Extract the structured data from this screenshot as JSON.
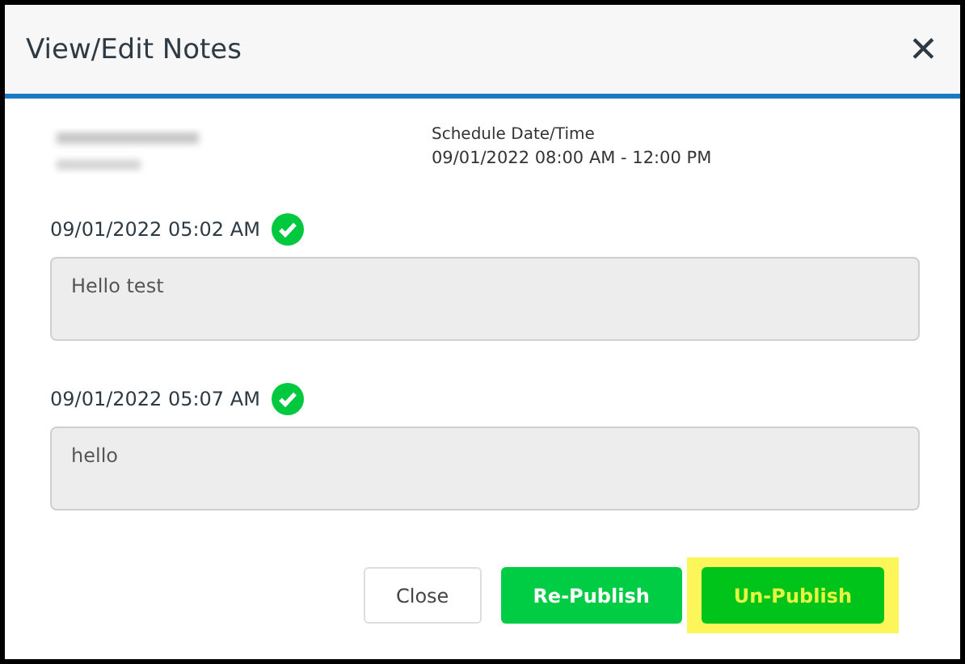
{
  "window": {
    "title": "View/Edit Notes",
    "close": "✕"
  },
  "schedule": {
    "label": "Schedule Date/Time",
    "value": "09/01/2022 08:00 AM - 12:00 PM"
  },
  "notes": [
    {
      "timestamp": "09/01/2022 05:02 AM",
      "published": true,
      "text": "Hello test"
    },
    {
      "timestamp": "09/01/2022 05:07 AM",
      "published": true,
      "text": "hello"
    }
  ],
  "buttons": [
    {
      "label": "Close",
      "kind": "secondary",
      "highlighted": false
    },
    {
      "label": "Re-Publish",
      "kind": "primary",
      "highlighted": false
    },
    {
      "label": "Un-Publish",
      "kind": "primary",
      "highlighted": true
    }
  ]
}
